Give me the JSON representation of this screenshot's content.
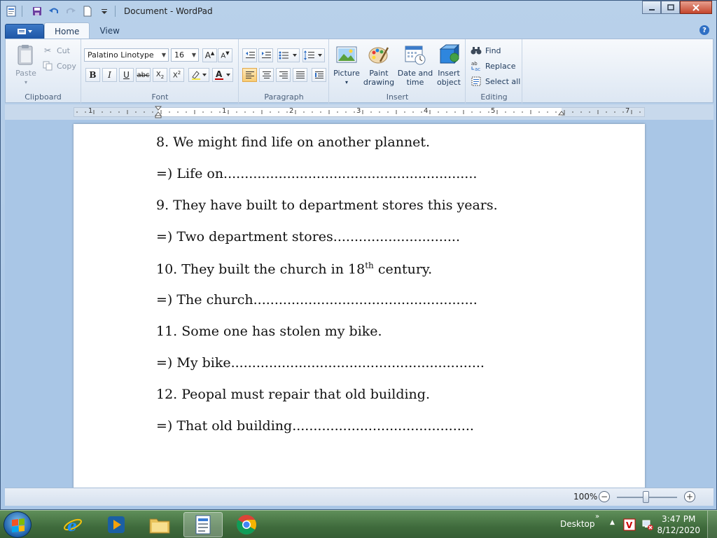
{
  "window": {
    "title": "Document - WordPad"
  },
  "ribbon": {
    "tabs": [
      "Home",
      "View"
    ],
    "clipboard": {
      "paste_label": "Paste",
      "cut_label": "Cut",
      "copy_label": "Copy",
      "group_label": "Clipboard"
    },
    "font": {
      "family_value": "Palatino Linotype",
      "size_value": "16",
      "group_label": "Font"
    },
    "paragraph": {
      "group_label": "Paragraph"
    },
    "insert": {
      "picture_label": "Picture",
      "paint_label_1": "Paint",
      "paint_label_2": "drawing",
      "datetime_label_1": "Date and",
      "datetime_label_2": "time",
      "object_label_1": "Insert",
      "object_label_2": "object",
      "group_label": "Insert"
    },
    "editing": {
      "find_label": "Find",
      "replace_label": "Replace",
      "selectall_label": "Select all",
      "group_label": "Editing"
    }
  },
  "ruler": {
    "labels": [
      "1",
      "1",
      "2",
      "3",
      "4",
      "5",
      "7"
    ]
  },
  "document": {
    "lines": [
      "8. We might find life on another plannet.",
      "=) Life on............................................................",
      "9. They have built to department stores this years.",
      "=) Two department stores..............................",
      "10. They built the church in 18",
      "=) The church.....................................................",
      "11. Some one has stolen my bike.",
      "=) My bike............................................................",
      "12. Peopal must repair that old building.",
      "=) That old building..........................................."
    ],
    "line10_sup": "th",
    "line10_tail": " century."
  },
  "statusbar": {
    "zoom": "100%",
    "zoom_level": 1.0
  },
  "taskbar": {
    "desktop_label": "Desktop",
    "time": "3:47 PM",
    "date": "8/12/2020"
  },
  "colors": {
    "ribbon_bg": "#dde7f3",
    "window_frame": "#b9d1ea",
    "taskbar": "#3f6b3c"
  }
}
